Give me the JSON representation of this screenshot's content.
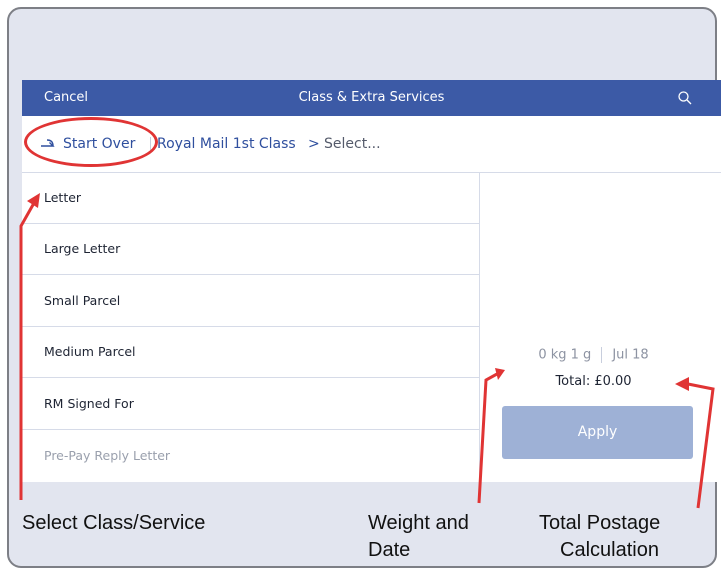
{
  "navbar": {
    "cancel_label": "Cancel",
    "title": "Class & Extra Services"
  },
  "breadcrumb": {
    "start_over_label": "Start Over",
    "class_label": "Royal Mail 1st Class",
    "chevron": ">",
    "current": "Select..."
  },
  "services": [
    {
      "label": "Letter"
    },
    {
      "label": "Large Letter"
    },
    {
      "label": "Small Parcel"
    },
    {
      "label": "Medium Parcel"
    },
    {
      "label": "RM Signed For"
    },
    {
      "label": "Pre-Pay Reply Letter"
    }
  ],
  "summary": {
    "weight": "0 kg 1 g",
    "date": "Jul 18",
    "total": "Total: £0.00",
    "apply_label": "Apply"
  },
  "annotations": {
    "select_class": "Select Class/Service",
    "weight_date_line1": "Weight and",
    "weight_date_line2": "Date",
    "total_line1": "Total Postage",
    "total_line2": "Calculation"
  },
  "colors": {
    "navbar": "#3c5aa6",
    "accent": "#2f4f9e",
    "apply_disabled": "#9eb1d6",
    "annotation": "#e03434",
    "frame_bg": "#e2e5ef"
  }
}
